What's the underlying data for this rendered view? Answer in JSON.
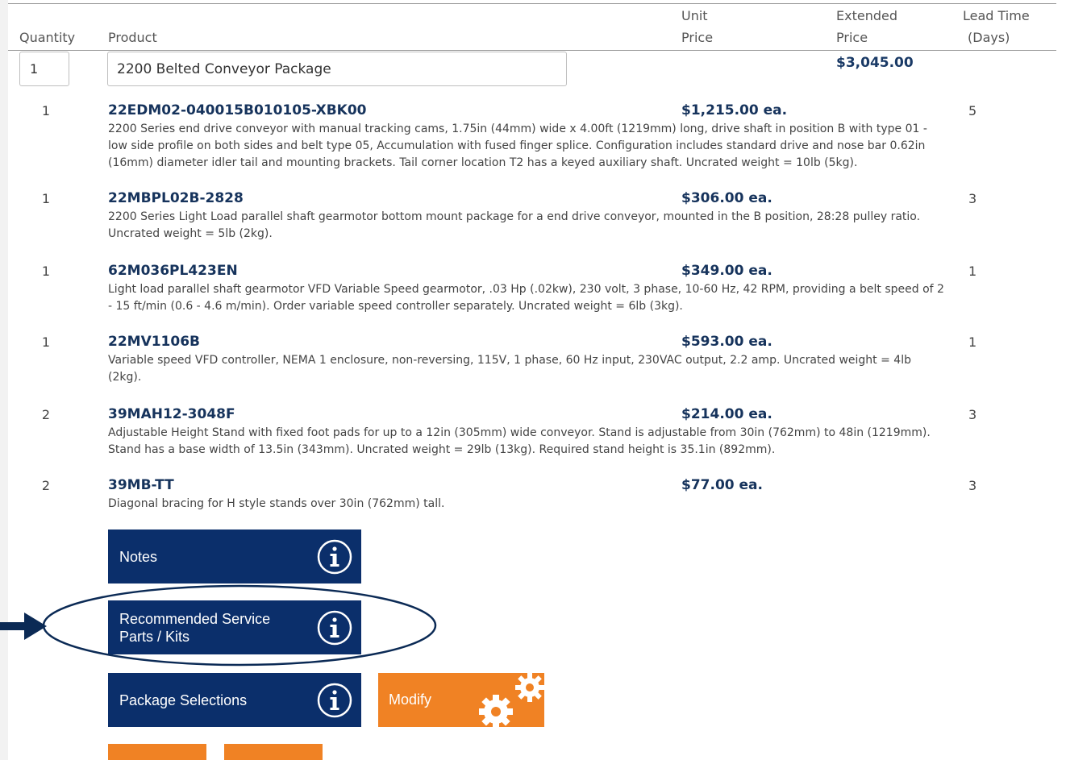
{
  "header": {
    "quantity": "Quantity",
    "product": "Product",
    "unit_price_1": "Unit",
    "unit_price_2": "Price",
    "extended_price_1": "Extended",
    "extended_price_2": "Price",
    "lead_time_1": "Lead Time",
    "lead_time_2": "(Days)"
  },
  "package": {
    "quantity": "1",
    "name": "2200 Belted Conveyor Package",
    "extended_price": "$3,045.00"
  },
  "items": [
    {
      "qty": "1",
      "sku": "22EDM02-040015B010105-XBK00",
      "price": "$1,215.00 ea.",
      "lead": "5",
      "desc": "2200 Series end drive conveyor with manual tracking cams, 1.75in (44mm) wide x 4.00ft (1219mm) long, drive shaft in position B with type 01 - low side profile on both sides and belt type 05, Accumulation with fused finger splice. Configuration includes standard drive and nose bar 0.62in (16mm) diameter idler tail and mounting brackets. Tail corner location T2 has a keyed auxiliary shaft. Uncrated weight = 10lb (5kg)."
    },
    {
      "qty": "1",
      "sku": "22MBPL02B-2828",
      "price": "$306.00 ea.",
      "lead": "3",
      "desc": "2200 Series Light Load parallel shaft gearmotor bottom mount package for a end drive conveyor, mounted in the B position, 28:28 pulley ratio. Uncrated weight = 5lb (2kg)."
    },
    {
      "qty": "1",
      "sku": "62M036PL423EN",
      "price": "$349.00 ea.",
      "lead": "1",
      "desc": "Light load parallel shaft gearmotor VFD Variable Speed gearmotor, .03 Hp (.02kw), 230 volt, 3 phase, 10-60 Hz, 42 RPM, providing a belt speed of 2 - 15 ft/min (0.6 - 4.6 m/min). Order variable speed controller separately. Uncrated weight = 6lb (3kg)."
    },
    {
      "qty": "1",
      "sku": "22MV1106B",
      "price": "$593.00 ea.",
      "lead": "1",
      "desc": "Variable speed VFD controller, NEMA 1 enclosure, non-reversing, 115V, 1 phase, 60 Hz input, 230VAC output, 2.2 amp. Uncrated weight = 4lb (2kg)."
    },
    {
      "qty": "2",
      "sku": "39MAH12-3048F",
      "price": "$214.00 ea.",
      "lead": "3",
      "desc": "Adjustable Height Stand with fixed foot pads for up to a 12in (305mm) wide conveyor. Stand is adjustable from 30in (762mm) to 48in (1219mm). Stand has a base width of 13.5in (343mm). Uncrated weight = 29lb (13kg). Required stand height is 35.1in (892mm)."
    },
    {
      "qty": "2",
      "sku": "39MB-TT",
      "price": "$77.00 ea.",
      "lead": "3",
      "desc": "Diagonal bracing for H style stands over 30in (762mm) tall."
    }
  ],
  "buttons": {
    "notes": "Notes",
    "service_1": "Recommended Service",
    "service_2": "Parts / Kits",
    "package_selections": "Package Selections",
    "modify": "Modify"
  },
  "colors": {
    "blue": "#0b2f6b",
    "orange": "#f08224",
    "sku_text": "#16335c"
  },
  "icons": {
    "info": "info-circle-icon",
    "gears": "gears-icon",
    "annotation": "annotation-arrow-icon"
  }
}
